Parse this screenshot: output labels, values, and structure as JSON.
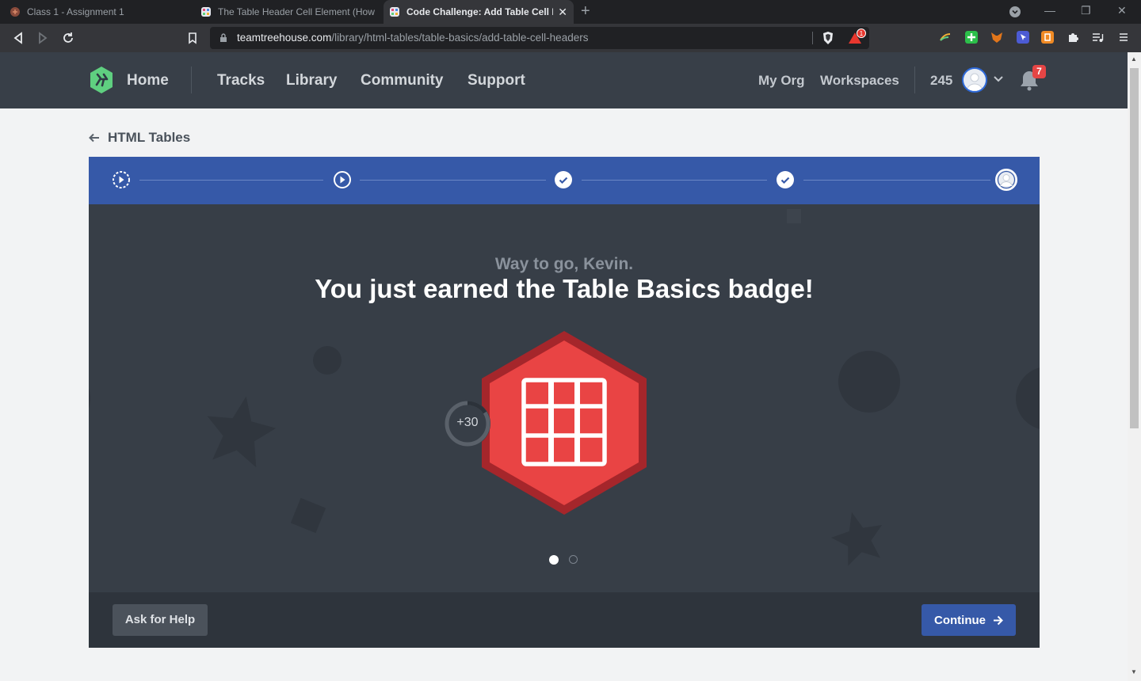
{
  "browser": {
    "tabs": [
      {
        "title": "Class 1 - Assignment 1",
        "active": false
      },
      {
        "title": "The Table Header Cell Element (How T",
        "active": false
      },
      {
        "title": "Code Challenge: Add Table Cell H",
        "active": true
      }
    ],
    "url_host": "teamtreehouse.com",
    "url_path": "/library/html-tables/table-basics/add-table-cell-headers",
    "brave_shield_count": "1"
  },
  "header": {
    "home": "Home",
    "nav": [
      "Tracks",
      "Library",
      "Community",
      "Support"
    ],
    "my_org": "My Org",
    "workspaces": "Workspaces",
    "points": "245",
    "notification_count": "7"
  },
  "breadcrumb": {
    "label": "HTML Tables"
  },
  "progress": {
    "steps": [
      "video",
      "video",
      "complete",
      "complete",
      "current"
    ]
  },
  "badge_screen": {
    "greeting": "Way to go, Kevin.",
    "headline": "You just earned the Table Basics badge!",
    "xp": "+30",
    "badge_color": "#e94444",
    "badge_border_color": "#a5262b",
    "pager": {
      "current": 1,
      "total": 2
    }
  },
  "footer": {
    "help_label": "Ask for Help",
    "continue_label": "Continue"
  },
  "colors": {
    "header_bg": "#383f48",
    "progress_bg": "#3659a8",
    "stage_bg": "#373e47",
    "accent_green": "#5fcf80"
  }
}
